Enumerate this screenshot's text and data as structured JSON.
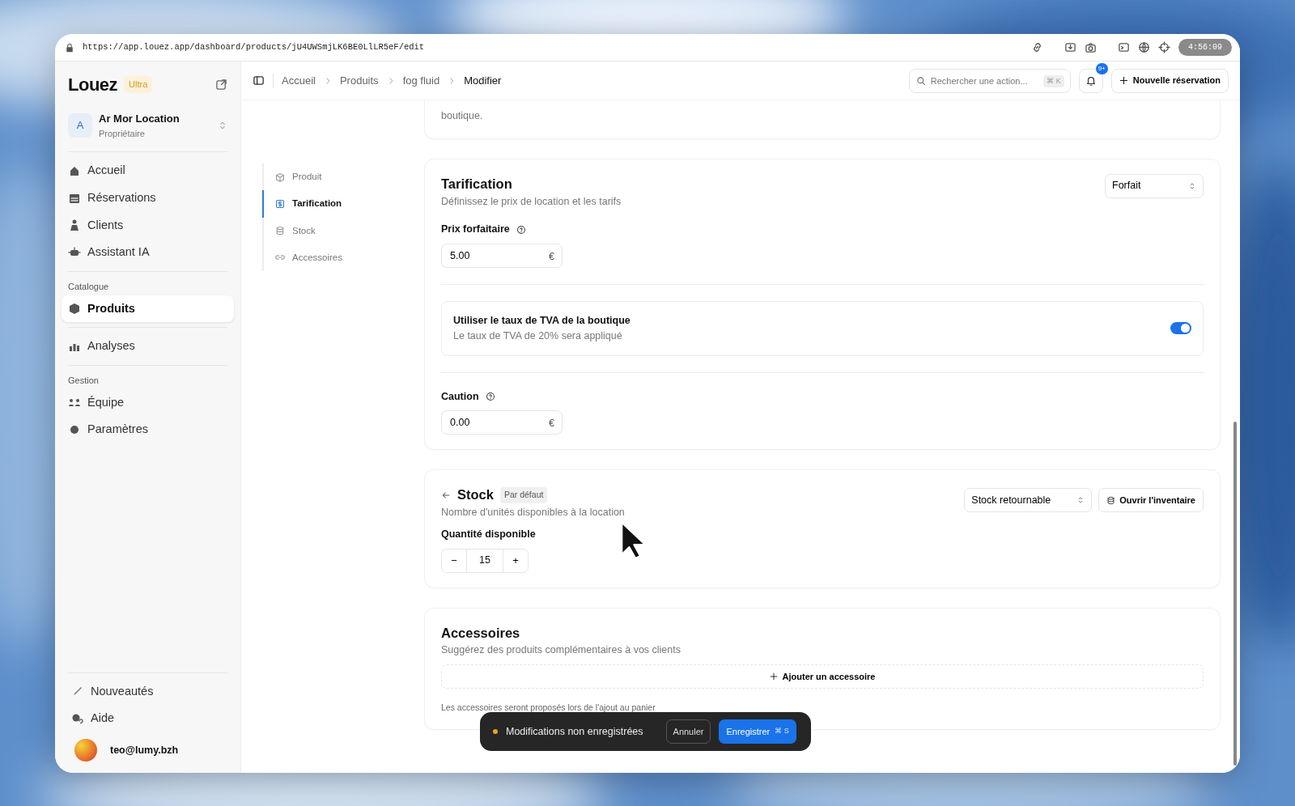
{
  "browser": {
    "url": "https://app.louez.app/dashboard/products/jU4UWSmjLK6BE0LlLR5eF/edit",
    "clock": "4:56:09"
  },
  "sidebar": {
    "brand": "Louez",
    "plan": "Ultra",
    "org": {
      "initial": "A",
      "name": "Ar Mor Location",
      "role": "Propriétaire"
    },
    "groups": [
      {
        "items": [
          {
            "label": "Accueil",
            "selected": false
          },
          {
            "label": "Réservations",
            "selected": false
          },
          {
            "label": "Clients",
            "selected": false
          },
          {
            "label": "Assistant IA",
            "selected": false
          }
        ]
      },
      {
        "label": "Catalogue",
        "items": [
          {
            "label": "Produits",
            "selected": true
          }
        ]
      },
      {
        "items": [
          {
            "label": "Analyses",
            "selected": false
          }
        ]
      },
      {
        "label": "Gestion",
        "items": [
          {
            "label": "Équipe",
            "selected": false
          },
          {
            "label": "Paramètres",
            "selected": false
          }
        ]
      }
    ],
    "footer_items": [
      {
        "label": "Nouveautés"
      },
      {
        "label": "Aide"
      }
    ],
    "user": {
      "email": "teo@lumy.bzh"
    }
  },
  "topbar": {
    "breadcrumbs": [
      "Accueil",
      "Produits",
      "fog fluid",
      "Modifier"
    ],
    "search": {
      "placeholder": "Rechercher une action...",
      "shortcut": "⌘ K"
    },
    "notifications": "9+",
    "new_button": "Nouvelle réservation"
  },
  "section_nav": [
    {
      "label": "Produit",
      "selected": false
    },
    {
      "label": "Tarification",
      "selected": true
    },
    {
      "label": "Stock",
      "selected": false
    },
    {
      "label": "Accessoires",
      "selected": false
    }
  ],
  "intro_tail": "boutique.",
  "pricing": {
    "title": "Tarification",
    "subtitle": "Définissez le prix de location et les tarifs",
    "mode": "Forfait",
    "price_label": "Prix forfaitaire",
    "price": "5.00",
    "price_currency": "€",
    "vat": {
      "title": "Utiliser le taux de TVA de la boutique",
      "subtitle": "Le taux de TVA de 20% sera appliqué",
      "on": true
    },
    "deposit_label": "Caution",
    "deposit": "0.00",
    "deposit_currency": "€"
  },
  "stock": {
    "title": "Stock",
    "badge": "Par défaut",
    "subtitle": "Nombre d'unités disponibles à la location",
    "type": "Stock retournable",
    "inventory_button": "Ouvrir l'inventaire",
    "qty_label": "Quantité disponible",
    "qty": "15",
    "minus": "−",
    "plus": "+"
  },
  "accessories": {
    "title": "Accessoires",
    "subtitle": "Suggérez des produits complémentaires à vos clients",
    "add_button": "Ajouter un accessoire",
    "note": "Les accessoires seront proposés lors de l'ajout au panier"
  },
  "save_bar": {
    "message": "Modifications non enregistrées",
    "cancel": "Annuler",
    "save": "Enregistrer",
    "shortcut": "⌘ S"
  }
}
